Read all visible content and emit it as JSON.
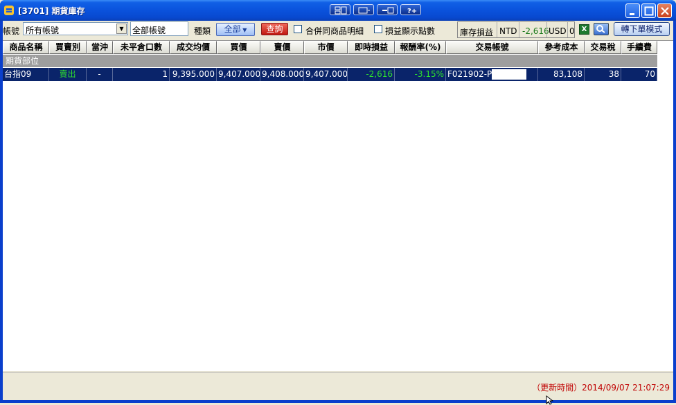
{
  "window": {
    "title": "[3701] 期貨庫存"
  },
  "toolbar": {
    "account_label": "帳號",
    "account_value": "所有帳號",
    "account_text": "全部帳號",
    "category_label": "種類",
    "all_button": "全部",
    "query_button": "查詢",
    "merge_checkbox_label": "合併同商品明細",
    "points_checkbox_label": "損益顯示點數",
    "pl_label": "庫存損益",
    "ntd_label": "NTD",
    "ntd_value": "-2,616",
    "usd_label": "USD",
    "usd_value": "0",
    "excel_icon": "X",
    "mode_button": "轉下單模式"
  },
  "table": {
    "columns": [
      "商品名稱",
      "買賣別",
      "當沖",
      "未平倉口數",
      "成交均價",
      "買價",
      "賣價",
      "市價",
      "即時損益",
      "報酬率(%)",
      "交易帳號",
      "參考成本",
      "交易稅",
      "手續費"
    ],
    "group_label": "期貨部位",
    "rows": [
      {
        "product": "台指09",
        "side": "賣出",
        "daytrade": "-",
        "open_qty": "1",
        "avg_price": "9,395.000",
        "bid": "9,407.000",
        "ask": "9,408.000",
        "market": "9,407.000",
        "pl": "-2,616",
        "return_pct": "-3.15%",
        "account": "F021902-P02",
        "ref_cost": "83,108",
        "tax": "38",
        "fee": "70"
      }
    ]
  },
  "status": {
    "update_time": "（更新時間）2014/09/07 21:07:29"
  },
  "colors": {
    "titlebar": "#0a52dc",
    "selected_row": "#0a246a",
    "positive_green": "#2ee02e",
    "status_red": "#c00000"
  }
}
